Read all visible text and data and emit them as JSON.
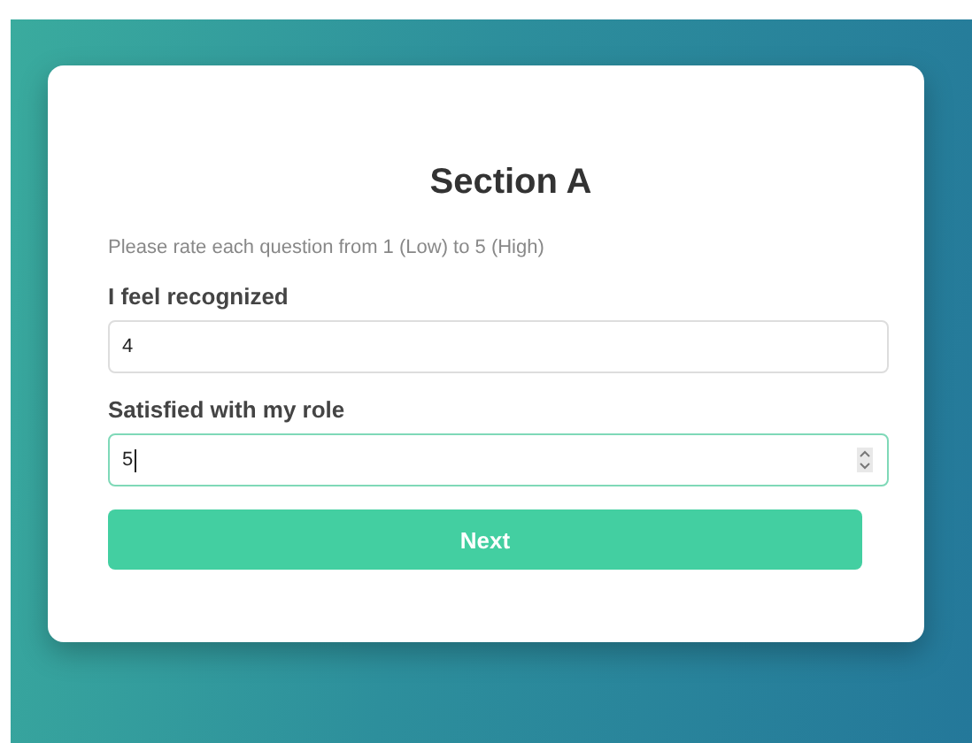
{
  "title": "Section A",
  "hint": "Please rate each question from 1 (Low) to 5 (High)",
  "questions": [
    {
      "label": "I feel recognized",
      "value": "4",
      "focused": false
    },
    {
      "label": "Satisfied with my role",
      "value": "5",
      "focused": true
    }
  ],
  "button": "Next"
}
